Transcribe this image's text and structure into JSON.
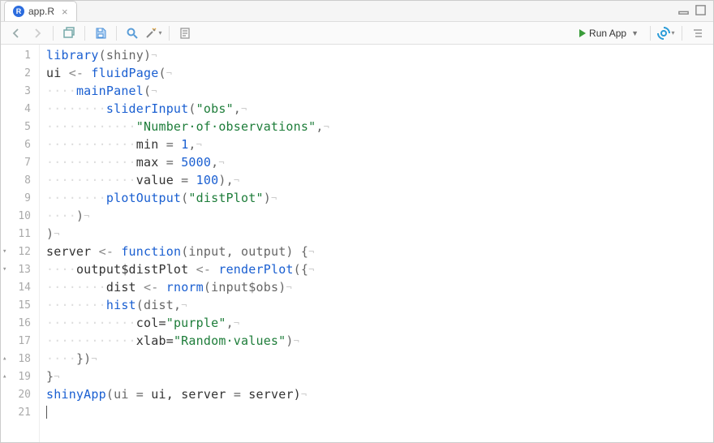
{
  "tab": {
    "filename": "app.R"
  },
  "toolbar": {
    "run_label": "Run App"
  },
  "gutter": {
    "lines": [
      "1",
      "2",
      "3",
      "4",
      "5",
      "6",
      "7",
      "8",
      "9",
      "10",
      "11",
      "12",
      "13",
      "14",
      "15",
      "16",
      "17",
      "18",
      "19",
      "20",
      "21"
    ],
    "folds": {
      "12": "▾",
      "13": "▾",
      "18": "▴",
      "19": "▴"
    }
  },
  "code": {
    "ws2": "··",
    "ws4": "····",
    "ws6": "······",
    "ws8": "········",
    "ws10": "··········",
    "ws12": "············",
    "nl": "¬",
    "l1": {
      "a": "library",
      "b": "(shiny)"
    },
    "l2": {
      "a": "ui",
      "b": "<-",
      "c": "fluidPage",
      "d": "("
    },
    "l3": {
      "a": "mainPanel",
      "b": "("
    },
    "l4": {
      "a": "sliderInput",
      "b": "(",
      "c": "\"obs\"",
      "d": ","
    },
    "l5": {
      "a": "\"Number·of·observations\"",
      "b": ","
    },
    "l6": {
      "a": "min",
      "b": "=",
      "c": "1",
      "d": ","
    },
    "l7": {
      "a": "max",
      "b": "=",
      "c": "5000",
      "d": ","
    },
    "l8": {
      "a": "value",
      "b": "=",
      "c": "100",
      "d": "),"
    },
    "l9": {
      "a": "plotOutput",
      "b": "(",
      "c": "\"distPlot\"",
      "d": ")"
    },
    "l10": {
      "a": ")"
    },
    "l11": {
      "a": ")"
    },
    "l12": {
      "a": "server",
      "b": "<-",
      "c": "function",
      "d": "(input,",
      "e": "output)",
      "f": "{"
    },
    "l13": {
      "a": "output$distPlot",
      "b": "<-",
      "c": "renderPlot",
      "d": "({"
    },
    "l14": {
      "a": "dist",
      "b": "<-",
      "c": "rnorm",
      "d": "(input$obs)"
    },
    "l15": {
      "a": "hist",
      "b": "(dist,"
    },
    "l16": {
      "a": "col=",
      "b": "\"purple\"",
      "c": ","
    },
    "l17": {
      "a": "xlab=",
      "b": "\"Random·values\"",
      "c": ")"
    },
    "l18": {
      "a": "})"
    },
    "l19": {
      "a": "}"
    },
    "l20": {
      "a": "shinyApp",
      "b": "(ui",
      "c": "=",
      "d": "ui,",
      "e": "server",
      "f": "=",
      "g": "server)"
    }
  }
}
